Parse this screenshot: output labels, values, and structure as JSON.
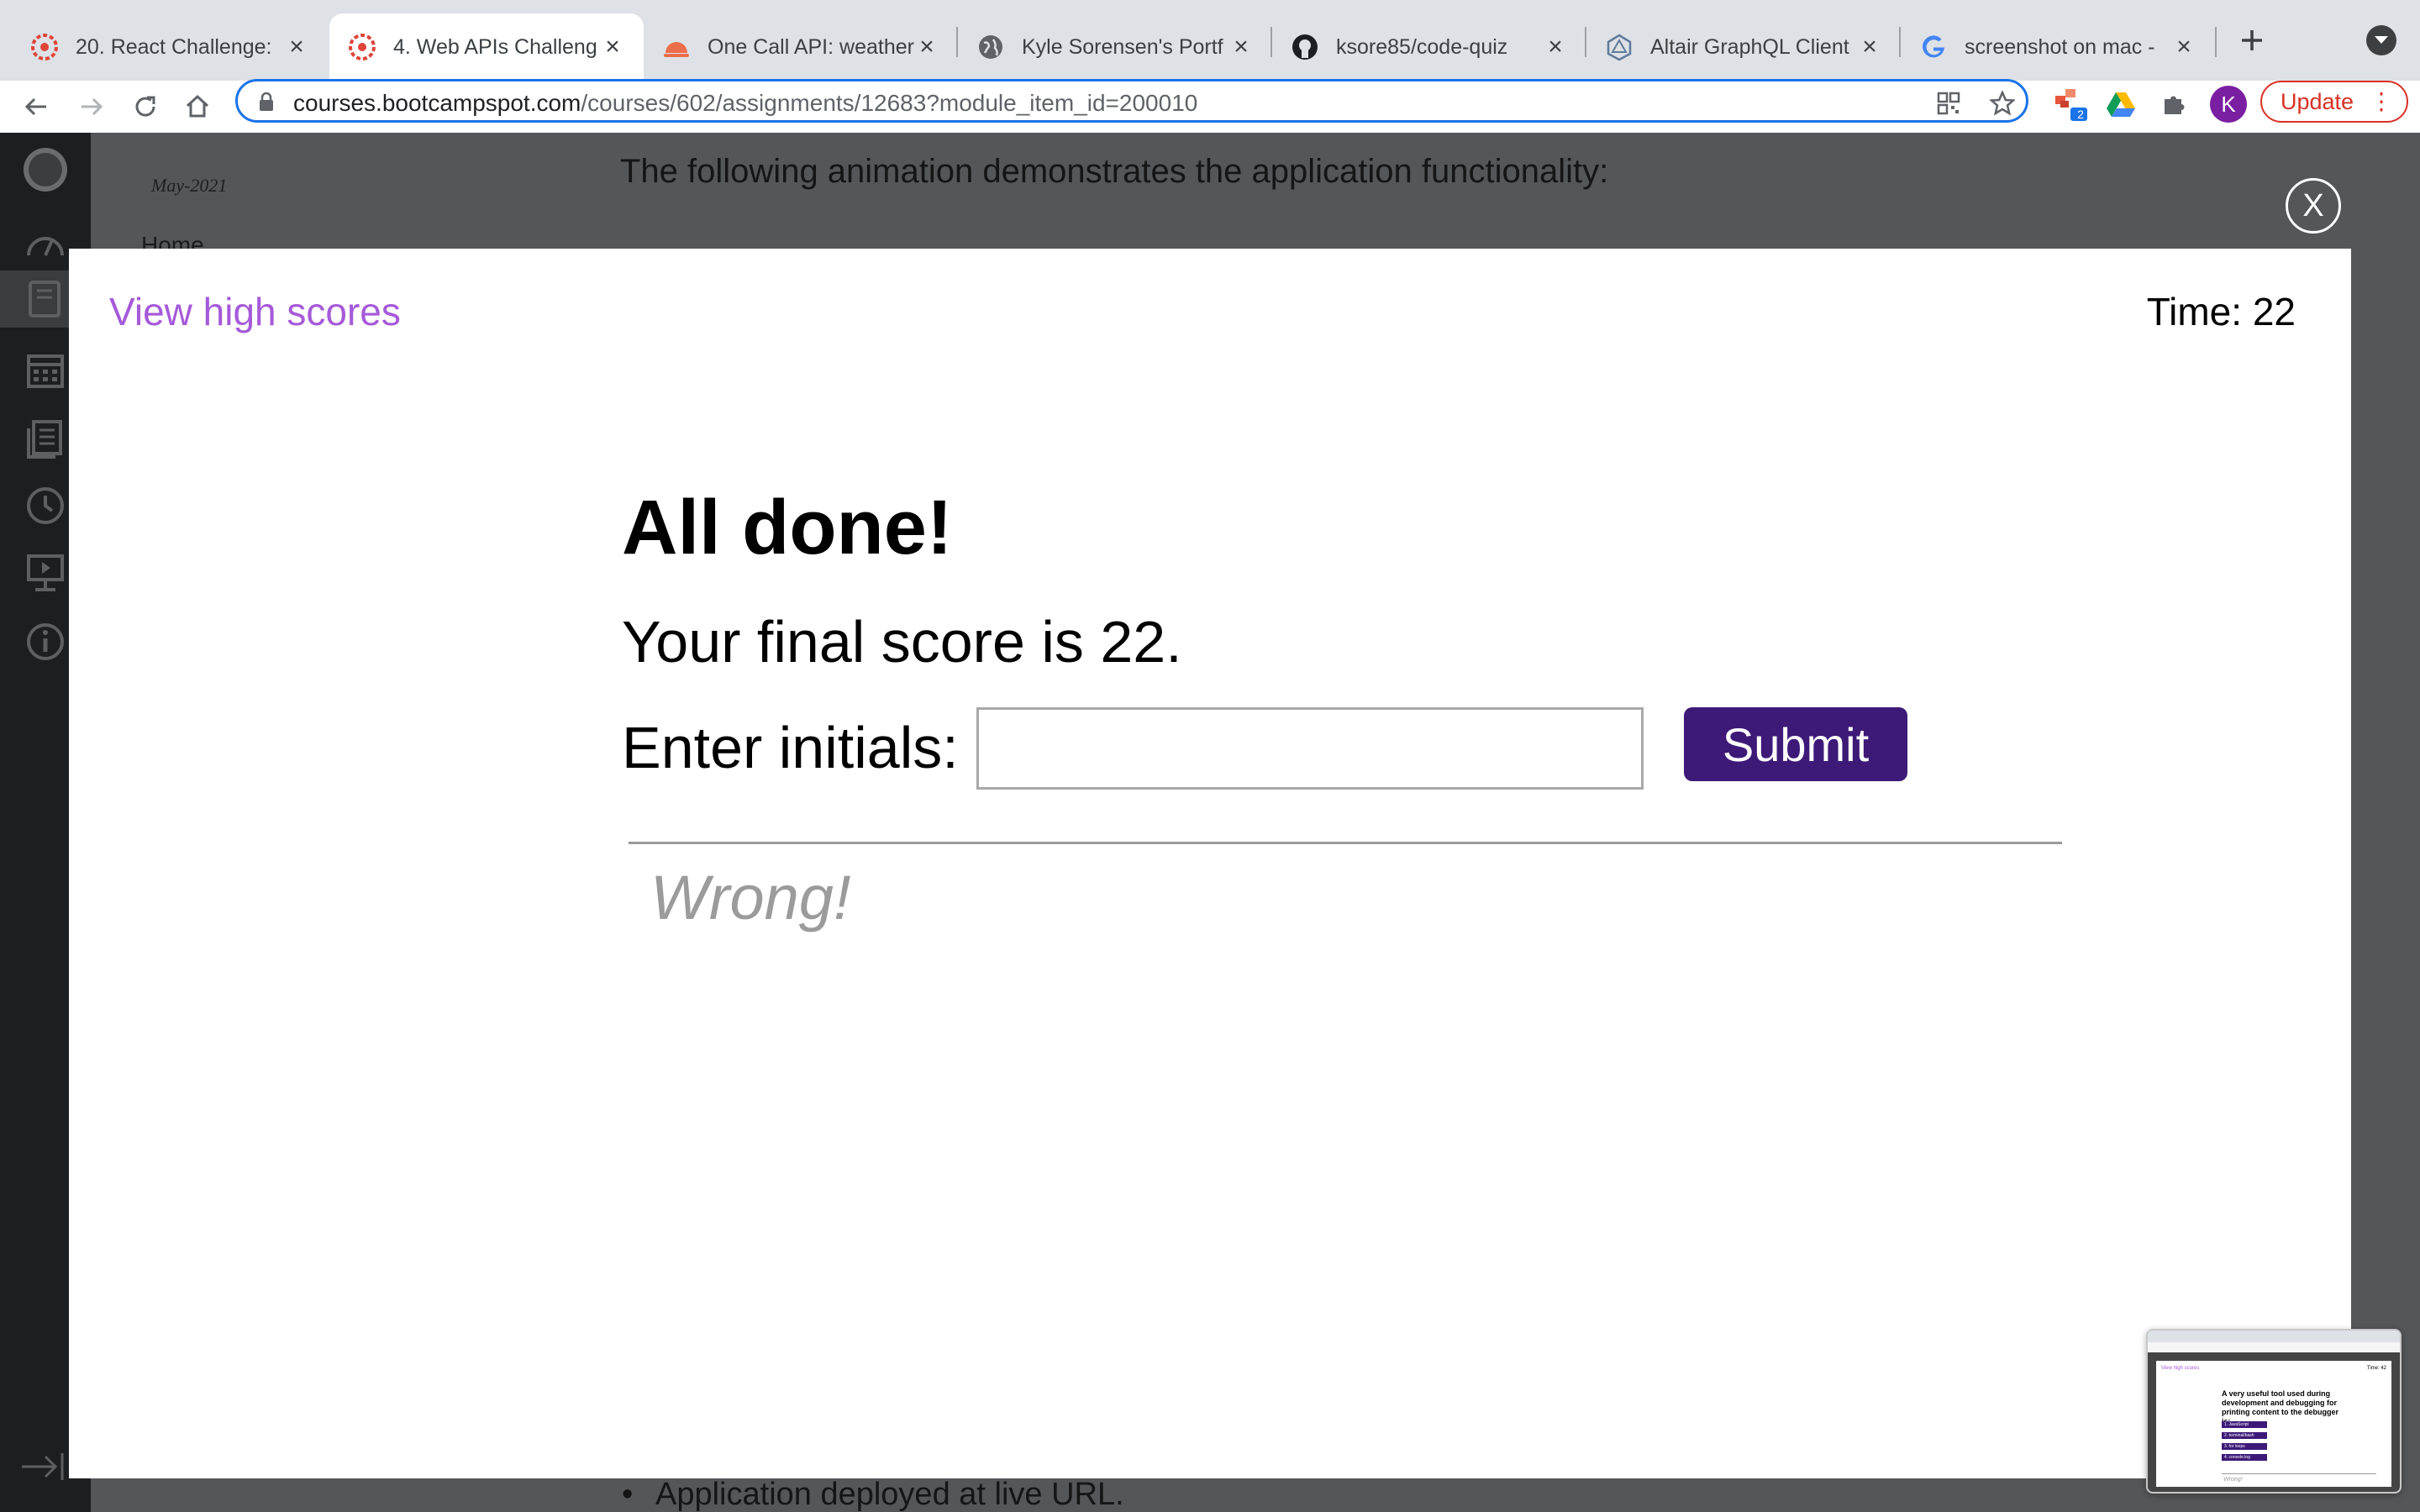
{
  "browser": {
    "tabs": [
      {
        "title": "20. React Challenge: ",
        "icon": "canvas-icon",
        "active": false
      },
      {
        "title": "4. Web APIs Challeng",
        "icon": "canvas-icon",
        "active": true
      },
      {
        "title": "One Call API: weather",
        "icon": "openweather-icon",
        "active": false
      },
      {
        "title": "Kyle Sorensen's Portf",
        "icon": "globe-icon",
        "active": false
      },
      {
        "title": "ksore85/code-quiz",
        "icon": "github-icon",
        "active": false
      },
      {
        "title": "Altair GraphQL Client",
        "icon": "altair-icon",
        "active": false
      },
      {
        "title": "screenshot on mac - ",
        "icon": "google-icon",
        "active": false
      }
    ],
    "url_domain": "courses.bootcampspot.com",
    "url_path": "/courses/602/assignments/12683?module_item_id=200010",
    "extension_badge": "2",
    "avatar_letter": "K",
    "update_label": "Update"
  },
  "background_page": {
    "cohort": "May-2021",
    "home_label": "Home",
    "intro_text": "The following animation demonstrates the application functionality:",
    "bullet_text": "Application deployed at live URL."
  },
  "lightbox": {
    "close_label": "X"
  },
  "quiz": {
    "view_high_scores": "View high scores",
    "timer": "Time: 22",
    "title": "All done!",
    "final_score": "Your final score is 22.",
    "initials_label": "Enter initials:",
    "initials_value": "",
    "submit_label": "Submit",
    "feedback": "Wrong!"
  },
  "thumbnail": {
    "question": "A very useful tool used during development and debugging for printing content to the debugger is:",
    "options": [
      "1. JavaScript",
      "2. terminal/bash",
      "3. for loops",
      "4. console.log"
    ],
    "view_high_scores": "View high scores",
    "timer": "Time: 42",
    "feedback": "Wrong!"
  },
  "colors": {
    "accent_purple": "#a55ad9",
    "submit_bg": "#3d1a78",
    "update_red": "#d93025",
    "omnibox_blue": "#1a73e8"
  }
}
